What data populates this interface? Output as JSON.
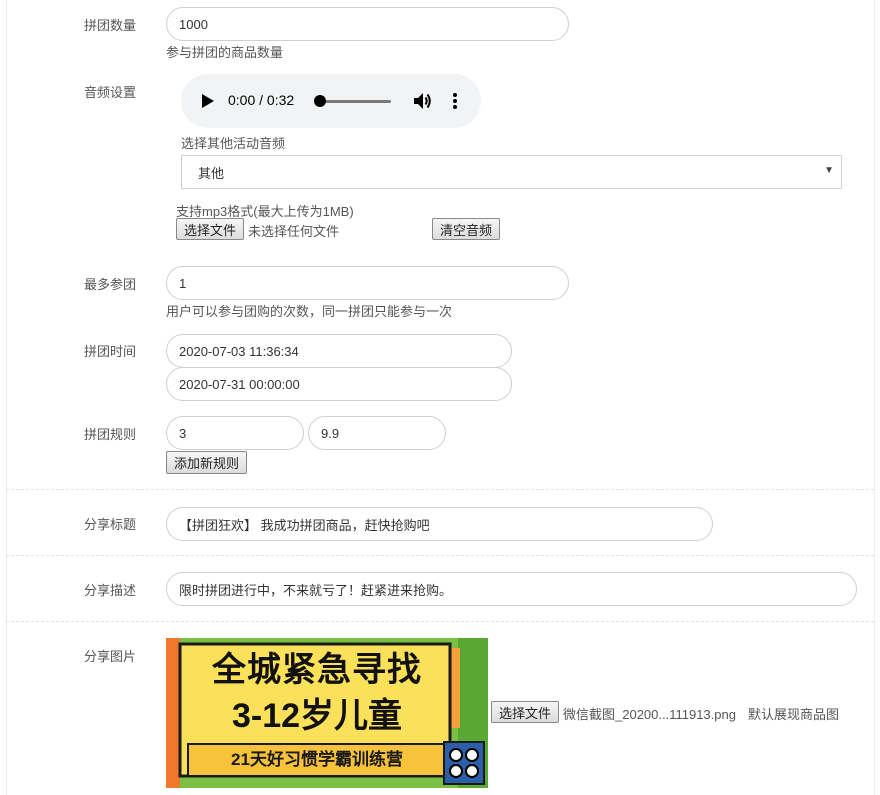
{
  "group_count": {
    "label": "拼团数量",
    "value": "1000",
    "help": "参与拼团的商品数量"
  },
  "audio_setting": {
    "label": "音频设置",
    "player_time": "0:00 / 0:32",
    "other_audio_label": "选择其他活动音频",
    "select_value": "其他",
    "support_text": "支持mp3格式(最大上传为1MB)",
    "choose_file_label": "选择文件",
    "no_file_text": "未选择任何文件",
    "clear_audio_label": "清空音频"
  },
  "max_join": {
    "label": "最多参团",
    "value": "1",
    "help": "用户可以参与团购的次数，同一拼团只能参与一次"
  },
  "group_time": {
    "label": "拼团时间",
    "start": "2020-07-03 11:36:34",
    "end": "2020-07-31 00:00:00"
  },
  "group_rules": {
    "label": "拼团规则",
    "people": "3",
    "price": "9.9",
    "add_rule_label": "添加新规则"
  },
  "share_title": {
    "label": "分享标题",
    "value": "【拼团狂欢】 我成功拼团商品，赶快抢购吧"
  },
  "share_desc": {
    "label": "分享描述",
    "value": "限时拼团进行中，不来就亏了！赶紧进来抢购。"
  },
  "share_image": {
    "label": "分享图片",
    "choose_file_label": "选择文件",
    "file_name": "微信截图_20200...111913.png",
    "default_text": "默认展现商品图",
    "poster_line1": "全城紧急寻找",
    "poster_line2": "3-12岁儿童",
    "poster_line3": "21天好习惯学霸训练营"
  }
}
